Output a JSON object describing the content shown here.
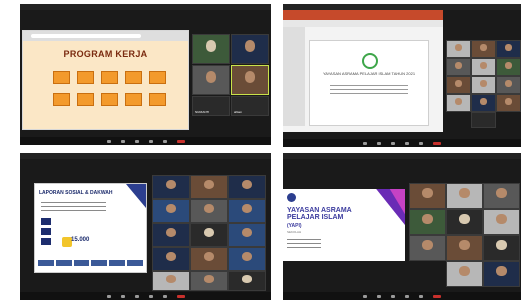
{
  "panel1": {
    "slide_title": "PROGRAM KERJA",
    "tiles": [
      {
        "name": "",
        "tone": "green hijab"
      },
      {
        "name": "",
        "tone": "navy"
      },
      {
        "name": "",
        "tone": "gray"
      },
      {
        "name": "",
        "tone": "brown active"
      },
      {
        "name": "NURIANTI",
        "tone": "name-only"
      },
      {
        "name": "ahlam",
        "tone": "name-only"
      }
    ]
  },
  "panel2": {
    "slide_heading": "YAYASAN ASRAMA PELAJAR ISLAM TAHUN 2021"
  },
  "panel3": {
    "doc_heading": "LAPORAN SOSIAL & DAKWAH",
    "big_number": "15.000"
  },
  "panel4": {
    "title_line1": "YAYASAN ASRAMA",
    "title_line2": "PELAJAR ISLAM",
    "title_line3": "(YAPI)",
    "subtitle": "SEKOLAH"
  },
  "colors": {
    "zoom_bg": "#1a1a1a",
    "end_button": "#c8302c",
    "slide_orange": "#f39a2c",
    "yapi_blue": "#3b3b9e",
    "yapi_purple": "#6a2bb5",
    "active_speaker": "#c9e24a"
  }
}
